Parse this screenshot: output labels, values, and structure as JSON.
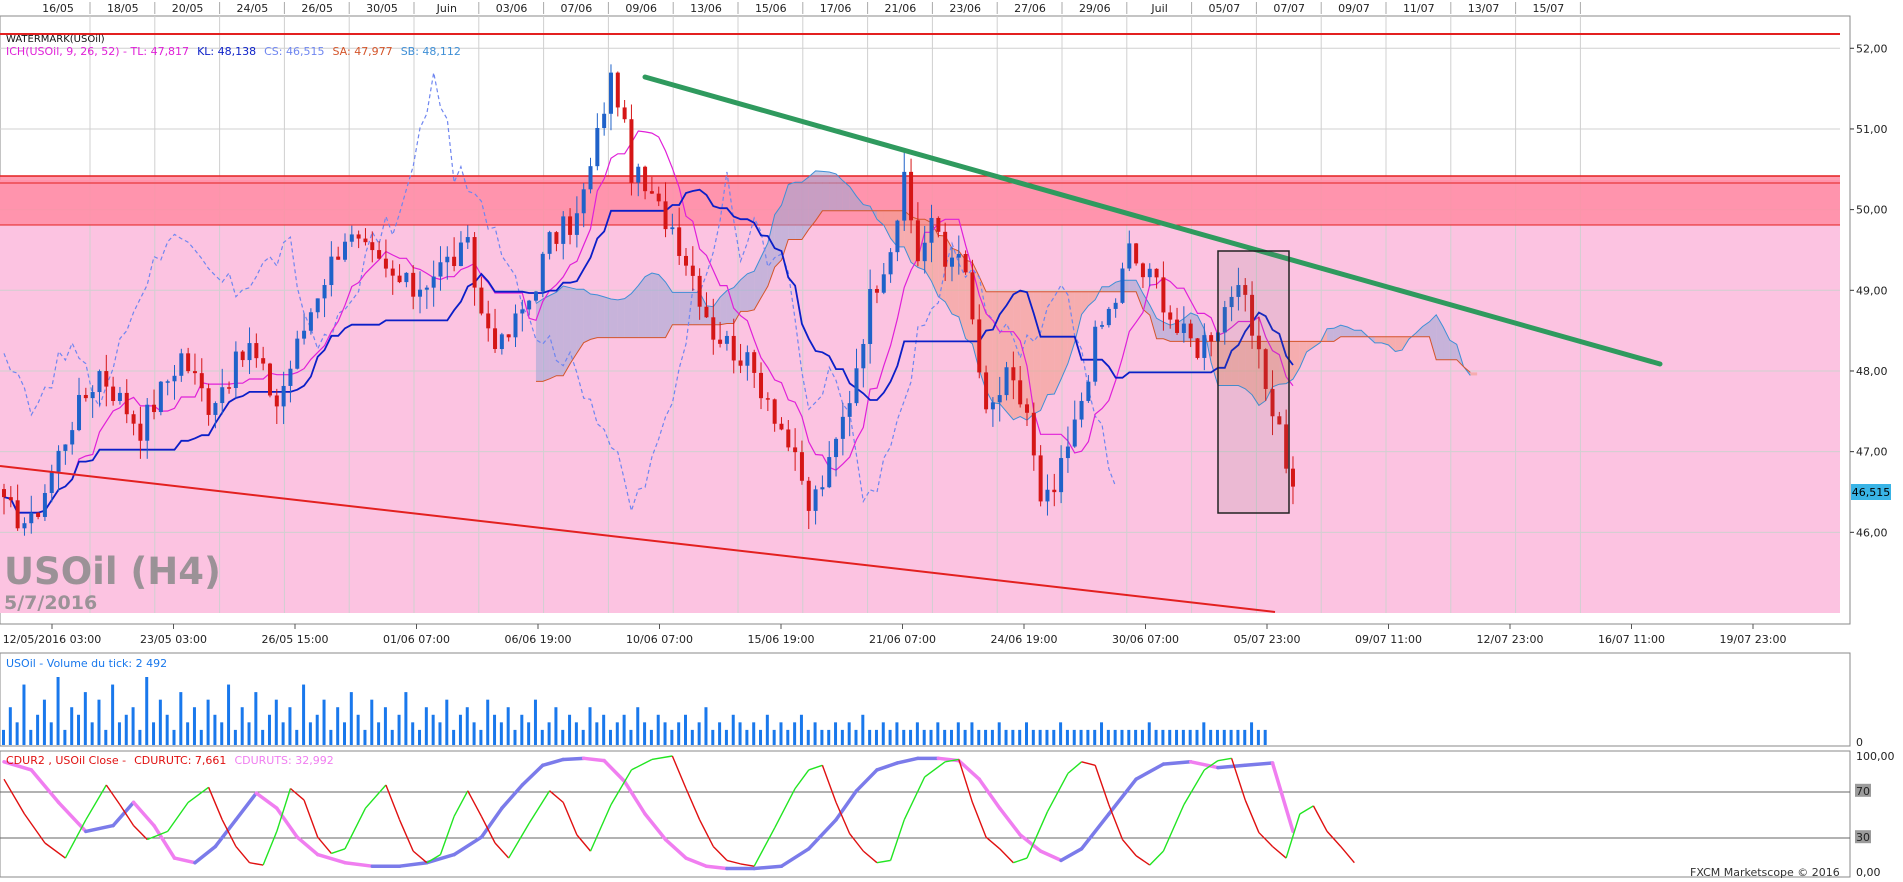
{
  "colors": {
    "bull": "#1f62c9",
    "bear": "#d51616",
    "tenkan": "#e020d8",
    "kijun": "#0b1fc8",
    "chikou": "#6f86f0",
    "senkou_a": "#3f8fd6",
    "senkou_b": "#d4552a",
    "zone_bg": "#fcc3e1",
    "resistance": "#ff8ca3",
    "green_trend": "#2f9a5e",
    "red_trend": "#e32020",
    "volume": "#1978ec",
    "cdur_red": "#e01010",
    "cdur_green": "#22e522",
    "cdur_magenta": "#f07ef0",
    "cdur_blue": "#7b7bea",
    "price_tag": "#39b4e6"
  },
  "main_panel": {
    "watermark_label": "WATERMARK(USOil)",
    "legend": [
      {
        "text": "ICH(USOil, 9, 26, 52) -  TL: 47,817",
        "color": "#e020d8"
      },
      {
        "text": "KL: 48,138",
        "color": "#0b1fc8"
      },
      {
        "text": "CS: 46,515",
        "color": "#6f86f0"
      },
      {
        "text": "SA: 47,977",
        "color": "#d4552a"
      },
      {
        "text": "SB: 48,112",
        "color": "#3f8fd6"
      }
    ],
    "big_title": "USOil (H4)",
    "big_date": "5/7/2016",
    "last_price": "46,515"
  },
  "top_axis": [
    "16/05",
    "18/05",
    "20/05",
    "24/05",
    "26/05",
    "30/05",
    "Juin",
    "03/06",
    "07/06",
    "09/06",
    "13/06",
    "15/06",
    "17/06",
    "21/06",
    "23/06",
    "27/06",
    "29/06",
    "Juil",
    "05/07",
    "07/07",
    "09/07",
    "11/07",
    "13/07",
    "15/07"
  ],
  "bottom_axis": [
    "12/05/2016 03:00",
    "23/05 03:00",
    "26/05 15:00",
    "01/06 07:00",
    "06/06 19:00",
    "10/06 07:00",
    "15/06 19:00",
    "21/06 07:00",
    "24/06 19:00",
    "30/06 07:00",
    "05/07 23:00",
    "09/07 11:00",
    "12/07 23:00",
    "16/07 11:00",
    "19/07 23:00"
  ],
  "price_axis": [
    "52,00",
    "51,00",
    "50,00",
    "49,00",
    "48,00",
    "47,00",
    "46,00"
  ],
  "volume_panel": {
    "label": "USOil - Volume du tick: 2 492",
    "axis_zero": "0"
  },
  "cdur_panel": {
    "legend": [
      {
        "text": "CDUR2 , USOil Close -",
        "color": "#e01010"
      },
      {
        "text": "CDURUTC: 7,661",
        "color": "#e01010"
      },
      {
        "text": "CDURUTS: 32,992",
        "color": "#f07ef0"
      }
    ],
    "axis": [
      "100,00",
      "70",
      "30",
      "0,00"
    ],
    "credit": "FXCM Marketscope © 2016"
  },
  "chart_data": [
    {
      "type": "candlestick",
      "symbol": "USOil",
      "timeframe": "H4",
      "ylim": [
        45.0,
        52.4
      ],
      "last_close": 46.515,
      "indicator": "Ichimoku (9, 26, 52)",
      "indicator_values": {
        "TL": 47.817,
        "KL": 48.138,
        "CS": 46.515,
        "SA": 47.977,
        "SB": 48.112
      },
      "resistance_zone": [
        49.8,
        50.4
      ],
      "resistance_line": 52.2,
      "close_path": [
        [
          0,
          46.3
        ],
        [
          4,
          46.1
        ],
        [
          10,
          47.4
        ],
        [
          14,
          48.0
        ],
        [
          20,
          47.3
        ],
        [
          26,
          48.2
        ],
        [
          30,
          47.6
        ],
        [
          36,
          48.3
        ],
        [
          40,
          47.6
        ],
        [
          46,
          49.0
        ],
        [
          50,
          49.7
        ],
        [
          56,
          49.2
        ],
        [
          60,
          49.0
        ],
        [
          64,
          49.3
        ],
        [
          68,
          49.5
        ],
        [
          70,
          48.7
        ],
        [
          73,
          48.3
        ],
        [
          77,
          48.9
        ],
        [
          80,
          49.6
        ],
        [
          84,
          49.9
        ],
        [
          86,
          50.5
        ],
        [
          88,
          51.3
        ],
        [
          89,
          51.6
        ],
        [
          90,
          51.4
        ],
        [
          92,
          50.5
        ],
        [
          95,
          50.1
        ],
        [
          98,
          49.8
        ],
        [
          101,
          49.2
        ],
        [
          104,
          48.5
        ],
        [
          108,
          48.2
        ],
        [
          112,
          47.7
        ],
        [
          115,
          47.1
        ],
        [
          118,
          46.3
        ],
        [
          121,
          46.8
        ],
        [
          124,
          47.7
        ],
        [
          127,
          48.9
        ],
        [
          130,
          49.6
        ],
        [
          132,
          50.3
        ],
        [
          134,
          49.4
        ],
        [
          136,
          49.9
        ],
        [
          138,
          49.3
        ],
        [
          140,
          49.6
        ],
        [
          142,
          48.6
        ],
        [
          144,
          47.4
        ],
        [
          147,
          47.9
        ],
        [
          150,
          47.5
        ],
        [
          152,
          46.3
        ],
        [
          154,
          46.5
        ],
        [
          157,
          47.3
        ],
        [
          160,
          48.4
        ],
        [
          163,
          48.9
        ],
        [
          165,
          49.5
        ],
        [
          167,
          49.2
        ],
        [
          169,
          49.1
        ],
        [
          172,
          48.5
        ],
        [
          175,
          48.3
        ],
        [
          178,
          48.6
        ],
        [
          180,
          49.0
        ],
        [
          182,
          48.8
        ],
        [
          184,
          48.1
        ],
        [
          187,
          47.3
        ],
        [
          189,
          46.5
        ]
      ]
    },
    {
      "type": "bar",
      "title": "USOil - Volume du tick",
      "last_value": 2492,
      "values": [
        2,
        5,
        3,
        8,
        2,
        4,
        6,
        3,
        9,
        2,
        5,
        4,
        7,
        3,
        6,
        2,
        8,
        3,
        4,
        5,
        2,
        9,
        3,
        6,
        4,
        2,
        7,
        3,
        5,
        2,
        6,
        4,
        3,
        8,
        2,
        5,
        3,
        7,
        2,
        4,
        6,
        3,
        5,
        2,
        8,
        3,
        4,
        6,
        2,
        5,
        3,
        7,
        4,
        2,
        6,
        3,
        5,
        2,
        4,
        7,
        3,
        2,
        5,
        4,
        3,
        6,
        2,
        4,
        5,
        3,
        2,
        6,
        4,
        3,
        5,
        2,
        4,
        3,
        6,
        2,
        3,
        5,
        2,
        4,
        3,
        2,
        5,
        3,
        4,
        2,
        3,
        4,
        2,
        5,
        3,
        2,
        4,
        3,
        2,
        3,
        4,
        2,
        3,
        5,
        2,
        3,
        2,
        4,
        3,
        2,
        3,
        2,
        4,
        2,
        3,
        2,
        3,
        4,
        2,
        3,
        2,
        2,
        3,
        2,
        3,
        2,
        4,
        2,
        2,
        3,
        2,
        3,
        2,
        2,
        3,
        2,
        2,
        3,
        2,
        2,
        3,
        2,
        3,
        2,
        2,
        2,
        3,
        2,
        2,
        2,
        3,
        2,
        2,
        2,
        2,
        3,
        2,
        2,
        2,
        2,
        2,
        3,
        2,
        2,
        2,
        2,
        2,
        2,
        3,
        2,
        2,
        2,
        2,
        2,
        2,
        2,
        3,
        2,
        2,
        2,
        2,
        2,
        2,
        3,
        2,
        2,
        2,
        2,
        2,
        3
      ]
    },
    {
      "type": "line",
      "title": "CDUR2 , USOil Close",
      "ylim": [
        0,
        100
      ],
      "levels": [
        70,
        30
      ],
      "last_values": {
        "CDURUTC": 7.661,
        "CDURUTS": 32.992
      },
      "fast": [
        [
          0,
          80
        ],
        [
          3,
          50
        ],
        [
          6,
          25
        ],
        [
          9,
          12
        ],
        [
          12,
          45
        ],
        [
          15,
          75
        ],
        [
          17,
          58
        ],
        [
          19,
          40
        ],
        [
          21,
          28
        ],
        [
          24,
          35
        ],
        [
          27,
          60
        ],
        [
          30,
          73
        ],
        [
          32,
          45
        ],
        [
          34,
          22
        ],
        [
          36,
          8
        ],
        [
          38,
          6
        ],
        [
          40,
          35
        ],
        [
          42,
          72
        ],
        [
          44,
          62
        ],
        [
          46,
          30
        ],
        [
          48,
          16
        ],
        [
          50,
          20
        ],
        [
          53,
          55
        ],
        [
          56,
          75
        ],
        [
          58,
          45
        ],
        [
          60,
          18
        ],
        [
          62,
          8
        ],
        [
          64,
          15
        ],
        [
          66,
          48
        ],
        [
          68,
          70
        ],
        [
          70,
          48
        ],
        [
          72,
          25
        ],
        [
          74,
          12
        ],
        [
          77,
          42
        ],
        [
          80,
          70
        ],
        [
          82,
          60
        ],
        [
          84,
          32
        ],
        [
          86,
          18
        ],
        [
          89,
          58
        ],
        [
          92,
          88
        ],
        [
          95,
          97
        ],
        [
          98,
          100
        ],
        [
          100,
          72
        ],
        [
          102,
          45
        ],
        [
          104,
          22
        ],
        [
          106,
          10
        ],
        [
          108,
          7
        ],
        [
          110,
          5
        ],
        [
          113,
          38
        ],
        [
          116,
          72
        ],
        [
          118,
          88
        ],
        [
          120,
          92
        ],
        [
          122,
          60
        ],
        [
          124,
          33
        ],
        [
          126,
          18
        ],
        [
          128,
          8
        ],
        [
          130,
          10
        ],
        [
          132,
          45
        ],
        [
          135,
          82
        ],
        [
          138,
          95
        ],
        [
          140,
          97
        ],
        [
          142,
          60
        ],
        [
          144,
          30
        ],
        [
          146,
          20
        ],
        [
          148,
          8
        ],
        [
          150,
          12
        ],
        [
          153,
          52
        ],
        [
          156,
          85
        ],
        [
          158,
          95
        ],
        [
          160,
          92
        ],
        [
          162,
          58
        ],
        [
          164,
          28
        ],
        [
          166,
          14
        ],
        [
          168,
          6
        ],
        [
          170,
          18
        ],
        [
          173,
          58
        ],
        [
          176,
          88
        ],
        [
          178,
          96
        ],
        [
          180,
          98
        ],
        [
          182,
          62
        ],
        [
          184,
          34
        ],
        [
          186,
          22
        ],
        [
          188,
          12
        ],
        [
          190,
          50
        ],
        [
          192,
          57
        ],
        [
          194,
          35
        ],
        [
          196,
          22
        ],
        [
          198,
          8
        ]
      ],
      "slow": [
        [
          0,
          95
        ],
        [
          4,
          88
        ],
        [
          8,
          60
        ],
        [
          12,
          35
        ],
        [
          16,
          40
        ],
        [
          19,
          60
        ],
        [
          22,
          40
        ],
        [
          25,
          12
        ],
        [
          28,
          8
        ],
        [
          31,
          22
        ],
        [
          34,
          45
        ],
        [
          37,
          68
        ],
        [
          40,
          55
        ],
        [
          43,
          30
        ],
        [
          46,
          15
        ],
        [
          50,
          8
        ],
        [
          54,
          5
        ],
        [
          58,
          5
        ],
        [
          62,
          8
        ],
        [
          66,
          15
        ],
        [
          70,
          30
        ],
        [
          73,
          55
        ],
        [
          76,
          75
        ],
        [
          79,
          92
        ],
        [
          82,
          97
        ],
        [
          85,
          98
        ],
        [
          88,
          96
        ],
        [
          91,
          78
        ],
        [
          94,
          50
        ],
        [
          97,
          28
        ],
        [
          100,
          12
        ],
        [
          103,
          5
        ],
        [
          106,
          3
        ],
        [
          110,
          3
        ],
        [
          114,
          5
        ],
        [
          118,
          20
        ],
        [
          122,
          45
        ],
        [
          125,
          70
        ],
        [
          128,
          88
        ],
        [
          131,
          94
        ],
        [
          134,
          98
        ],
        [
          137,
          98
        ],
        [
          140,
          96
        ],
        [
          143,
          80
        ],
        [
          146,
          55
        ],
        [
          149,
          32
        ],
        [
          152,
          18
        ],
        [
          155,
          10
        ],
        [
          158,
          20
        ],
        [
          162,
          50
        ],
        [
          166,
          80
        ],
        [
          170,
          93
        ],
        [
          174,
          95
        ],
        [
          178,
          90
        ],
        [
          182,
          92
        ],
        [
          186,
          94
        ],
        [
          189,
          35
        ]
      ]
    }
  ]
}
